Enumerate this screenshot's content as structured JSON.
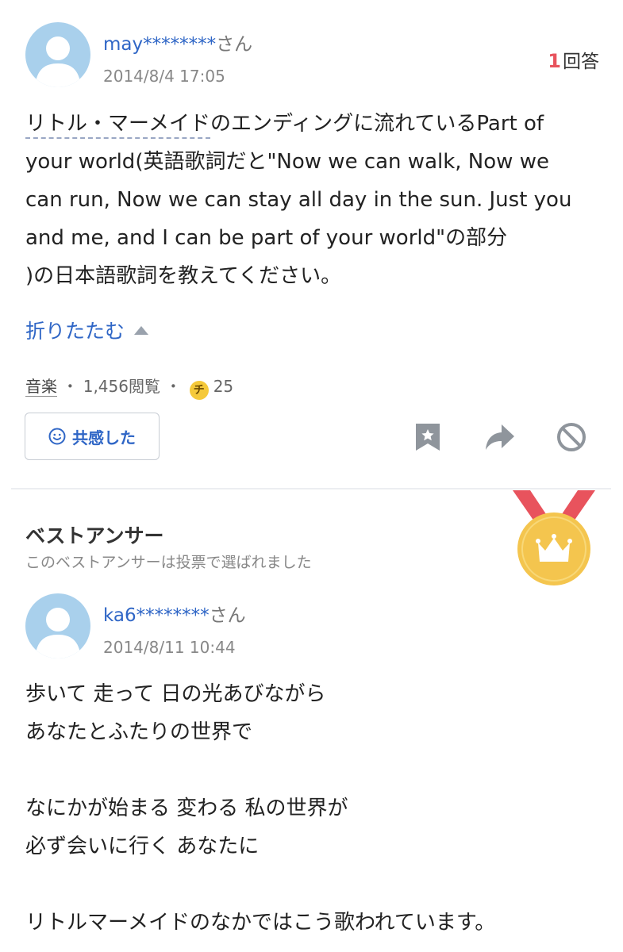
{
  "question": {
    "user": {
      "name": "may********",
      "suffix": "さん"
    },
    "date": "2014/8/4 17:05",
    "answers": {
      "count": "1",
      "label": "回答"
    },
    "body": {
      "line1_linked": "リトル・マーメイド",
      "line1_rest": "のエンディングに流れているPart of",
      "lines_rest": "your world(英語歌詞だと\"Now we can walk, Now we\ncan run, Now we can stay all day in the sun. Just you\nand me, and I can be part of your world\"の部分\n)の日本語歌詞を教えてください。"
    },
    "collapse_label": "折りたたむ",
    "meta": {
      "category": "音楽",
      "views": "1,456閲覧",
      "coin_glyph": "チ",
      "coins": "25"
    },
    "actions": {
      "empathy_label": "共感した",
      "icons": [
        "bookmark-icon",
        "share-icon",
        "block-icon"
      ]
    }
  },
  "best_answer": {
    "title": "ベストアンサー",
    "subtitle": "このベストアンサーは投票で選ばれました",
    "medal_icon": "crown-medal-icon",
    "user": {
      "name": "ka6********",
      "suffix": "さん"
    },
    "date": "2014/8/11 10:44",
    "body": "歩いて 走って 日の光あびながら\nあなたとふたりの世界で\n\nなにかが始まる 変わる 私の世界が\n必ず会いに行く あなたに\n\nリトルマーメイドのなかではこう歌われています。"
  },
  "colors": {
    "link": "#2f66c6",
    "count": "#e8535d",
    "medal_gold": "#f4c54e",
    "ribbon": "#e8535d"
  }
}
